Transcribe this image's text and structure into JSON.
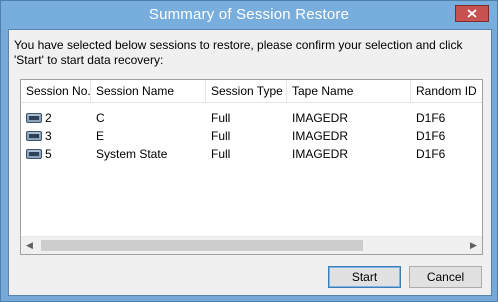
{
  "window": {
    "title": "Summary of Session Restore"
  },
  "message": "You have selected below sessions to restore, please confirm your selection and click 'Start' to start data recovery:",
  "table": {
    "columns": [
      "Session No.",
      "Session Name",
      "Session Type",
      "Tape Name",
      "Random ID"
    ],
    "rows": [
      {
        "session_no": "2",
        "session_name": "C",
        "session_type": "Full",
        "tape_name": "IMAGEDR",
        "random_id": "D1F6"
      },
      {
        "session_no": "3",
        "session_name": "E",
        "session_type": "Full",
        "tape_name": "IMAGEDR",
        "random_id": "D1F6"
      },
      {
        "session_no": "5",
        "session_name": "System State",
        "session_type": "Full",
        "tape_name": "IMAGEDR",
        "random_id": "D1F6"
      }
    ]
  },
  "buttons": {
    "start": "Start",
    "cancel": "Cancel"
  },
  "icons": {
    "row": "tape-drive-icon",
    "close": "close-icon",
    "scroll_left": "chevron-left-icon",
    "scroll_right": "chevron-right-icon"
  }
}
